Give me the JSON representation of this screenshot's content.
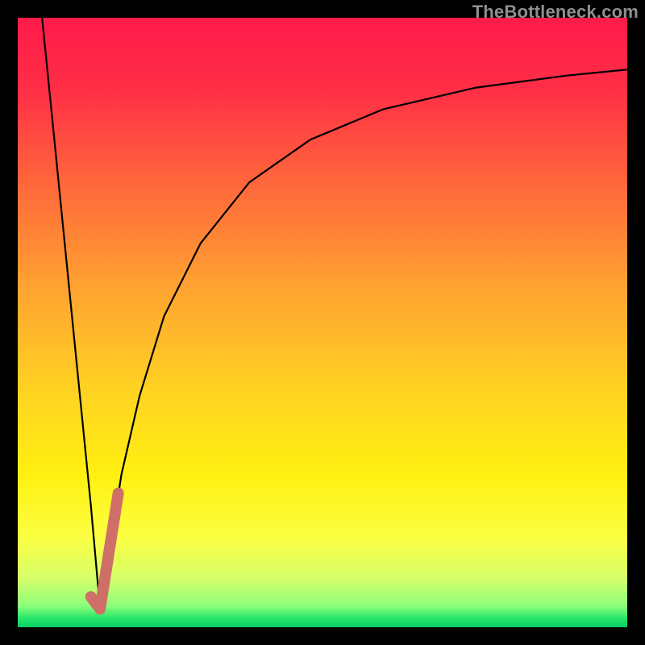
{
  "watermark": "TheBottleneck.com",
  "colors": {
    "frame": "#000000",
    "gradient_stops": [
      {
        "offset": 0.0,
        "color": "#ff1a4a"
      },
      {
        "offset": 0.12,
        "color": "#ff2f46"
      },
      {
        "offset": 0.28,
        "color": "#ff6a3a"
      },
      {
        "offset": 0.45,
        "color": "#ffa531"
      },
      {
        "offset": 0.62,
        "color": "#ffd421"
      },
      {
        "offset": 0.75,
        "color": "#fff011"
      },
      {
        "offset": 0.85,
        "color": "#fcff40"
      },
      {
        "offset": 0.92,
        "color": "#d6ff6a"
      },
      {
        "offset": 0.965,
        "color": "#8cff7a"
      },
      {
        "offset": 0.985,
        "color": "#29e56b"
      },
      {
        "offset": 1.0,
        "color": "#05cf63"
      }
    ],
    "curve": "#000000",
    "highlight": "#cf6f68"
  },
  "chart_data": {
    "type": "line",
    "title": "",
    "xlabel": "",
    "ylabel": "",
    "xlim": [
      0,
      100
    ],
    "ylim": [
      0,
      100
    ],
    "grid": false,
    "series": [
      {
        "name": "bottleneck-curve-left",
        "x": [
          4,
          6,
          8,
          10,
          12,
          13.5
        ],
        "values": [
          100,
          80,
          60,
          40,
          20,
          3
        ]
      },
      {
        "name": "bottleneck-curve-right",
        "x": [
          13.5,
          15,
          17,
          20,
          24,
          30,
          38,
          48,
          60,
          75,
          90,
          100
        ],
        "values": [
          3,
          12,
          25,
          38,
          51,
          63,
          73,
          80,
          85,
          88.5,
          90.5,
          91.5
        ]
      },
      {
        "name": "highlight-segment",
        "x": [
          12.0,
          13.5,
          16.5
        ],
        "values": [
          5,
          3,
          22
        ]
      }
    ],
    "annotations": [
      {
        "text": "TheBottleneck.com",
        "position": "top-right"
      }
    ]
  }
}
